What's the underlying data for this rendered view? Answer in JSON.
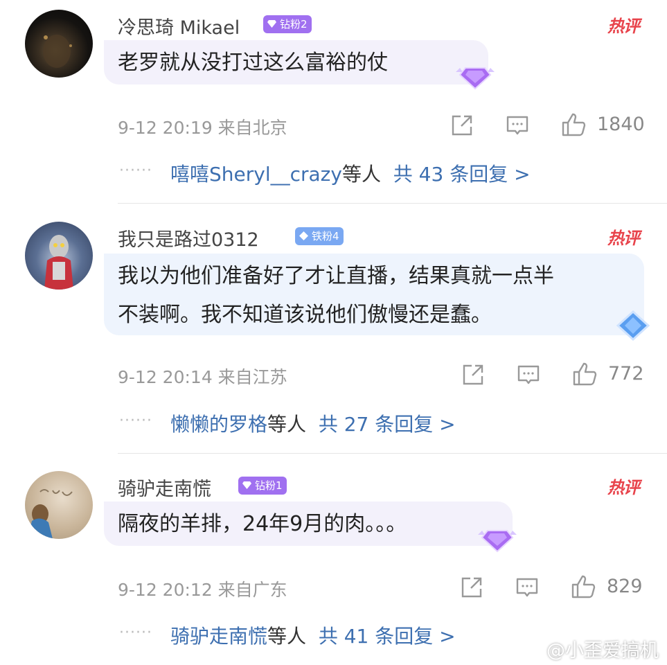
{
  "comments": [
    {
      "username": "冷思琦 Mikael",
      "badge": "钻粉2",
      "badge_color": "#a070f0",
      "hot_label": "热评",
      "text_lines": [
        "老罗就从没打过这么富裕的仗"
      ],
      "meta": "9-12 20:19 来自北京",
      "likes": "1840",
      "reply_users": "嘻嘻Sheryl__crazy",
      "reply_mid": "等人",
      "reply_link": "共 43 条回复 >"
    },
    {
      "username": "我只是路过0312",
      "badge": "铁粉4",
      "badge_color": "#7aa8f2",
      "hot_label": "热评",
      "text_lines": [
        "我以为他们准备好了才让直播，结果真就一点半",
        "不装啊。我不知道该说他们傲慢还是蠢。"
      ],
      "meta": "9-12 20:14 来自江苏",
      "likes": "772",
      "reply_users": "懒懒的罗格",
      "reply_mid": "等人",
      "reply_link": "共 27 条回复 >"
    },
    {
      "username": "骑驴走南慌",
      "badge": "钻粉1",
      "badge_color": "#a070f0",
      "hot_label": "热评",
      "text_lines": [
        "隔夜的羊排，24年9月的肉。。。"
      ],
      "meta": "9-12 20:12 来自广东",
      "likes": "829",
      "reply_users": "骑驴走南慌",
      "reply_mid": "等人",
      "reply_link": "共 41 条回复 >"
    }
  ],
  "dots": "······",
  "watermark": "@小歪爱搞机",
  "icons": {
    "share": "share-icon",
    "comment": "comment-icon",
    "like": "thumbs-up-icon",
    "gem": "diamond-icon",
    "watermark_logo": "weibo-logo-icon"
  },
  "colors": {
    "hot": "#e8434b",
    "link": "#3d6fb0",
    "meta": "#999999",
    "diamond_badge": "#a070f0",
    "iron_badge": "#7aa8f2"
  }
}
